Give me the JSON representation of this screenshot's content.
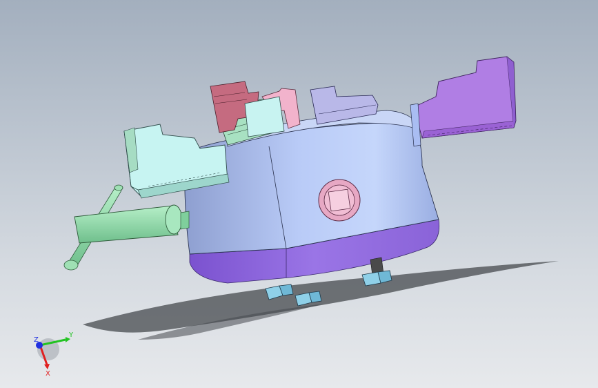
{
  "viewport": {
    "background_top": "#a3afbe",
    "background_bottom": "#e7e9ec"
  },
  "model": {
    "body_color": "#a9bdf2",
    "base_ring_color": "#8a63d8",
    "key_socket_color": "#e9a9c6",
    "handle_color": "#8fdca8",
    "jaw_colors": {
      "cyan": "#bff2f0",
      "mint": "#a6dfbf",
      "red": "#c86a7e",
      "pink": "#f2b3cc",
      "lavender": "#b7b6e6",
      "purple": "#b07ee4"
    },
    "bolt_color": "#8fd0e8",
    "shadow_color": "#4a4d52"
  },
  "triad": {
    "x_label": "X",
    "y_label": "Y",
    "z_label": "Z",
    "x_color": "#e02020",
    "y_color": "#22c322",
    "z_color": "#2030e0"
  }
}
